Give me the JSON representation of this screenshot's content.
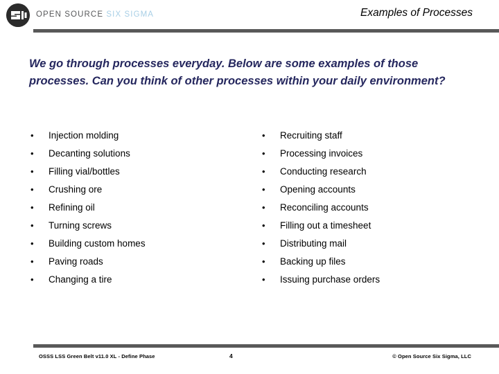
{
  "header": {
    "brand_open_source": "OPEN SOURCE ",
    "brand_six_sigma": "SIX SIGMA",
    "logo_icon": "open-source-six-sigma-logo",
    "title": "Examples of Processes",
    "rule_color": "#595959",
    "brand_open_color": "#58595b",
    "brand_six_color": "#a8cfe6"
  },
  "intro": {
    "text": "We go through processes everyday.  Below are some examples of those processes.  Can you think of other processes within your daily environment?",
    "color": "#25275e"
  },
  "columns": {
    "bullet_glyph": "•",
    "left": [
      {
        "label": "Injection molding"
      },
      {
        "label": "Decanting solutions"
      },
      {
        "label": "Filling vial/bottles"
      },
      {
        "label": "Crushing ore"
      },
      {
        "label": "Refining oil"
      },
      {
        "label": "Turning screws"
      },
      {
        "label": "Building custom homes"
      },
      {
        "label": "Paving roads"
      },
      {
        "label": "Changing a tire"
      }
    ],
    "right": [
      {
        "label": "Recruiting staff"
      },
      {
        "label": "Processing invoices"
      },
      {
        "label": "Conducting research"
      },
      {
        "label": "Opening accounts"
      },
      {
        "label": "Reconciling accounts"
      },
      {
        "label": "Filling out a timesheet"
      },
      {
        "label": "Distributing mail"
      },
      {
        "label": "Backing up files"
      },
      {
        "label": "Issuing purchase orders"
      }
    ]
  },
  "footer": {
    "left_text": "OSSS LSS Green Belt v11.0 XL - Define Phase",
    "page_number": "4",
    "right_text": "© Open Source Six Sigma, LLC",
    "rule_color": "#595959"
  }
}
